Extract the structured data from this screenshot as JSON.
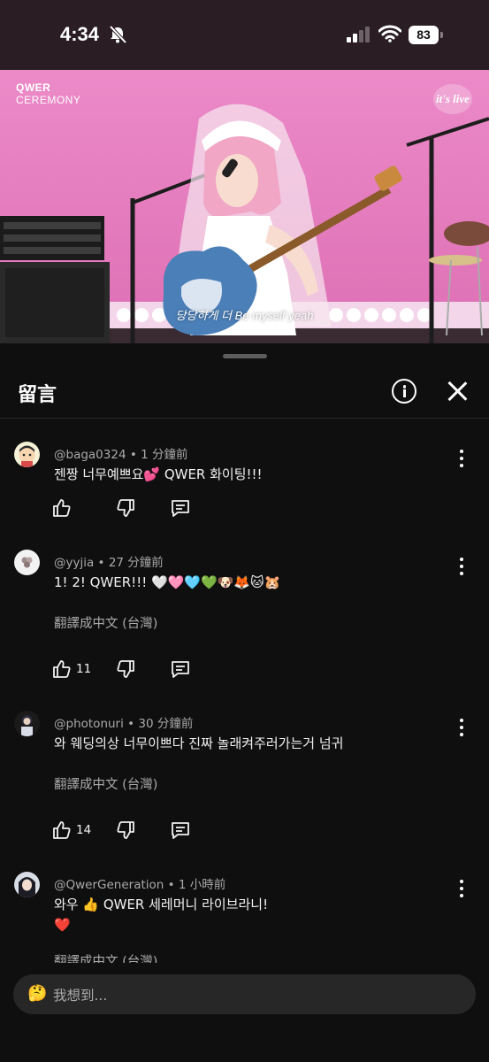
{
  "status_bar": {
    "time": "4:34",
    "battery": "83"
  },
  "video": {
    "brand_line1": "QWER",
    "brand_line2": "CEREMONY",
    "logo": "it's live",
    "subtitle": "당당하게 더 Be myself yeah"
  },
  "sheet": {
    "title": "留言",
    "input_placeholder": "我想到...",
    "input_emoji": "🤔"
  },
  "comments": [
    {
      "user": "@baga0324",
      "time": "1 分鐘前",
      "text": "젠짱 너무예쁘요💕 QWER 화이팅!!!",
      "likes": "",
      "translate": ""
    },
    {
      "user": "@yyjia",
      "time": "27 分鐘前",
      "text": "1! 2! QWER!!! 🤍🩷🩵💚🐶🦊🐱🐹",
      "likes": "11",
      "translate": "翻譯成中文 (台灣)"
    },
    {
      "user": "@photonuri",
      "time": "30 分鐘前",
      "text": "와 웨딩의상 너무이쁘다 진짜 놀래켜주러가는거 넘귀",
      "likes": "14",
      "translate": "翻譯成中文 (台灣)"
    },
    {
      "user": "@QwerGeneration",
      "time": "1 小時前",
      "text": "와우 👍 QWER 세레머니 라이브라니!",
      "text2": "❤️",
      "likes": "",
      "translate": "翻譯成中文 (台灣)"
    }
  ],
  "icons": [
    "bell-off-icon",
    "signal-icon",
    "wifi-icon",
    "battery-icon",
    "info-icon",
    "close-icon",
    "more-icon",
    "like-icon",
    "dislike-icon",
    "reply-icon"
  ]
}
